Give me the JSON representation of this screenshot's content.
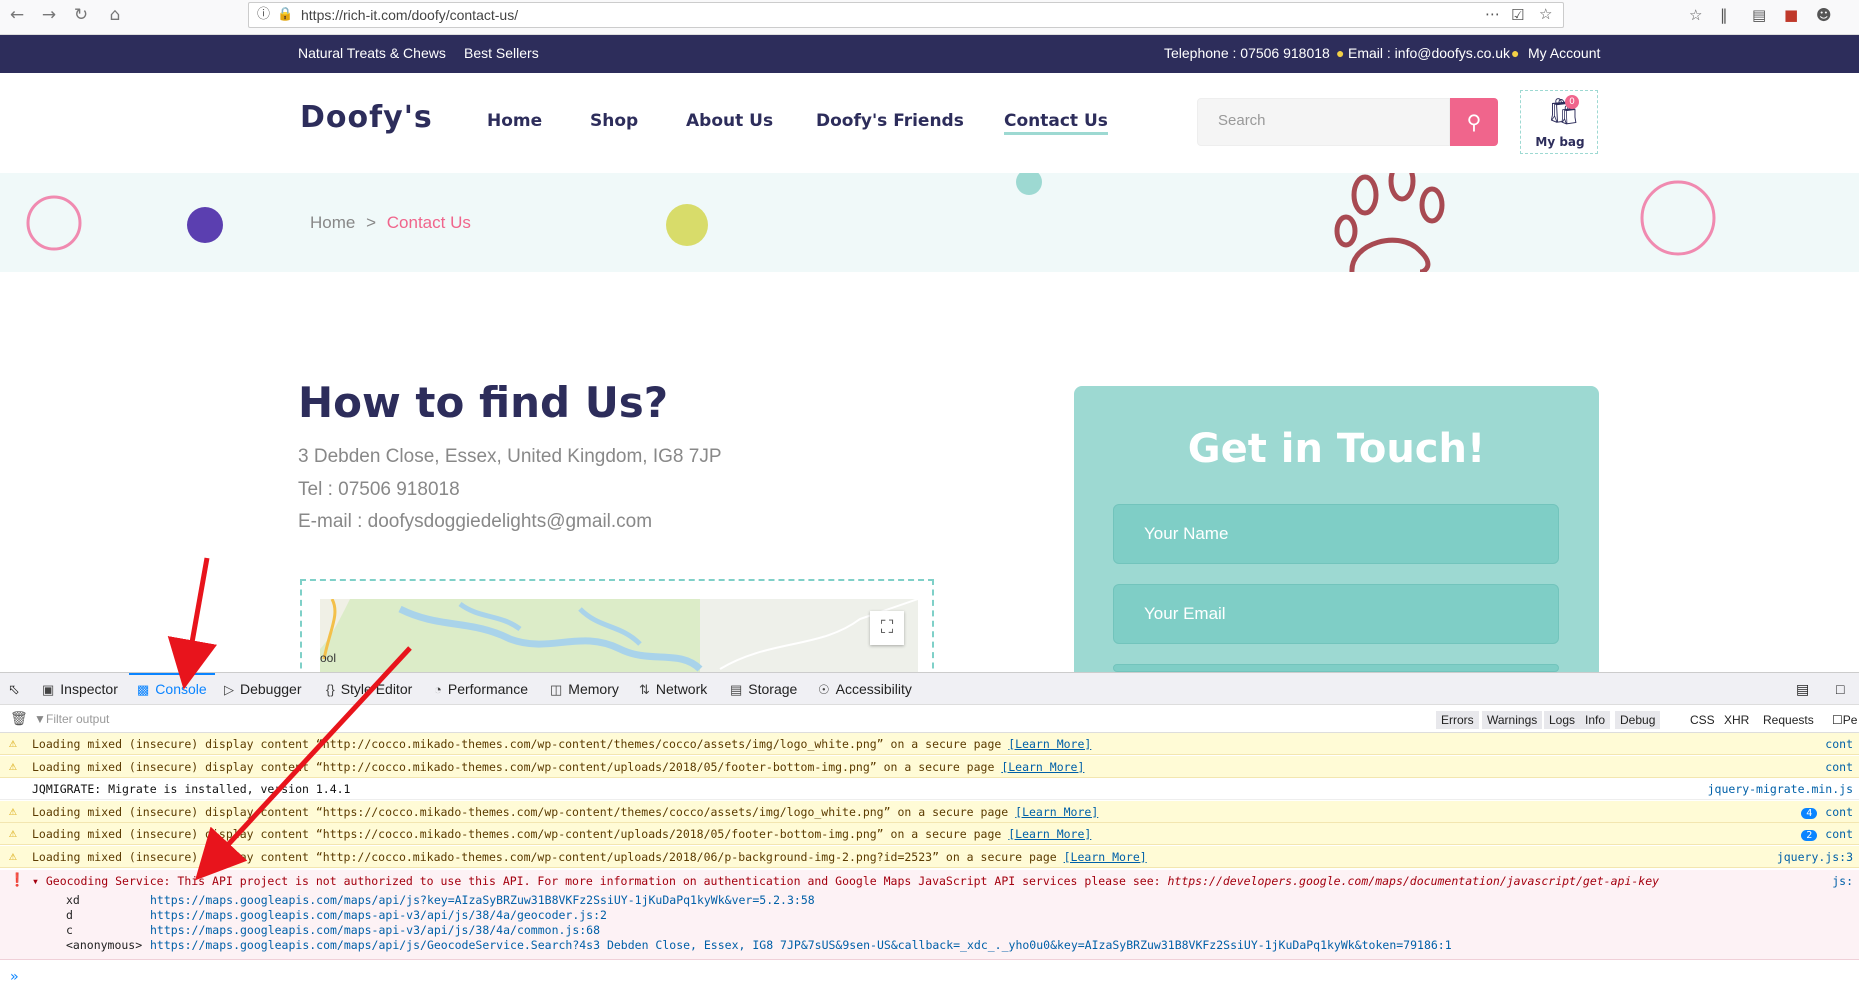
{
  "browser": {
    "url": "https://rich-it.com/doofy/contact-us/",
    "icons": [
      "back-icon",
      "forward-icon",
      "reload-icon",
      "home-icon",
      "info-icon",
      "lock-warning-icon",
      "more-icon",
      "pocket-icon",
      "bookmark-star-icon",
      "reading-list-icon",
      "library-icon",
      "sidebar-icon",
      "extension-icon",
      "account-icon"
    ]
  },
  "topbar": {
    "link1": "Natural Treats & Chews",
    "link2": "Best Sellers",
    "telephone": "Telephone : 07506 918018",
    "email": "Email : info@doofys.co.uk",
    "account": "My Account"
  },
  "header": {
    "logo": "Doofy's",
    "nav": [
      "Home",
      "Shop",
      "About Us",
      "Doofy's Friends",
      "Contact Us"
    ],
    "search_placeholder": "Search",
    "bag_count": "0",
    "bag_label": "My bag"
  },
  "breadcrumb": {
    "home": "Home",
    "sep": ">",
    "current": "Contact Us"
  },
  "main": {
    "title": "How to find Us?",
    "address": "3 Debden Close, Essex, United Kingdom, IG8 7JP",
    "tel": "Tel : 07506 918018",
    "email": "E-mail : doofysdoggiedelights@gmail.com",
    "map_label": "ool"
  },
  "form": {
    "title": "Get in Touch!",
    "name_placeholder": "Your Name",
    "email_placeholder": "Your Email"
  },
  "devtools": {
    "tabs": [
      "Inspector",
      "Console",
      "Debugger",
      "Style Editor",
      "Performance",
      "Memory",
      "Network",
      "Storage",
      "Accessibility"
    ],
    "filter_placeholder": "Filter output",
    "filter_buttons": [
      "Errors",
      "Warnings",
      "Logs",
      "Info",
      "Debug"
    ],
    "filter_types": [
      "CSS",
      "XHR",
      "Requests"
    ],
    "persist_label": "Pe",
    "messages": [
      {
        "type": "warn",
        "pre": "Loading mixed (insecure) display content “http://cocco.mikado-themes.com/wp-content/themes/cocco/assets/img/logo_white.png” on a secure page ",
        "link": "[Learn More]",
        "count": "",
        "src": "cont"
      },
      {
        "type": "warn",
        "pre": "Loading mixed (insecure) display content “http://cocco.mikado-themes.com/wp-content/uploads/2018/05/footer-bottom-img.png” on a secure page ",
        "link": "[Learn More]",
        "count": "",
        "src": "cont"
      },
      {
        "type": "plain",
        "pre": "JQMIGRATE: Migrate is installed, version 1.4.1",
        "link": "",
        "count": "",
        "src": "jquery-migrate.min.js"
      },
      {
        "type": "warn",
        "pre": "Loading mixed (insecure) display content “https://cocco.mikado-themes.com/wp-content/themes/cocco/assets/img/logo_white.png” on a secure page ",
        "link": "[Learn More]",
        "count": "4",
        "src": "cont"
      },
      {
        "type": "warn",
        "pre": "Loading mixed (insecure) display content “https://cocco.mikado-themes.com/wp-content/uploads/2018/05/footer-bottom-img.png” on a secure page ",
        "link": "[Learn More]",
        "count": "2",
        "src": "cont"
      },
      {
        "type": "warn",
        "pre": "Loading mixed (insecure) display content “http://cocco.mikado-themes.com/wp-content/uploads/2018/06/p-background-img-2.png?id=2523” on a secure page ",
        "link": "[Learn More]",
        "count": "",
        "src": "jquery.js:3"
      }
    ],
    "error": {
      "text": "Geocoding Service: This API project is not authorized to use this API.  For more information on authentication and Google Maps JavaScript API services please see: ",
      "url": "https://developers.google.com/maps/documentation/javascript/get-api-key",
      "src": "js:"
    },
    "stack": [
      {
        "fn": "xd",
        "url": "https://maps.googleapis.com/maps/api/js?key=AIzaSyBRZuw31B8VKFz2SsiUY-1jKuDaPq1kyWk&ver=5.2.3:58"
      },
      {
        "fn": "d",
        "url": "https://maps.googleapis.com/maps-api-v3/api/js/38/4a/geocoder.js:2"
      },
      {
        "fn": "c",
        "url": "https://maps.googleapis.com/maps-api-v3/api/js/38/4a/common.js:68"
      },
      {
        "fn": "<anonymous>",
        "url": "https://maps.googleapis.com/maps/api/js/GeocodeService.Search?4s3 Debden Close, Essex, IG8 7JP&7sUS&9sen-US&callback=_xdc_._yho0u0&key=AIzaSyBRZuw31B8VKFz2SsiUY-1jKuDaPq1kyWk&token=79186:1"
      }
    ],
    "prompt": "»"
  },
  "colors": {
    "navy": "#2d2d5b",
    "pink": "#f0658c",
    "teal": "#9dd9d2",
    "arrow": "#e8141c"
  }
}
